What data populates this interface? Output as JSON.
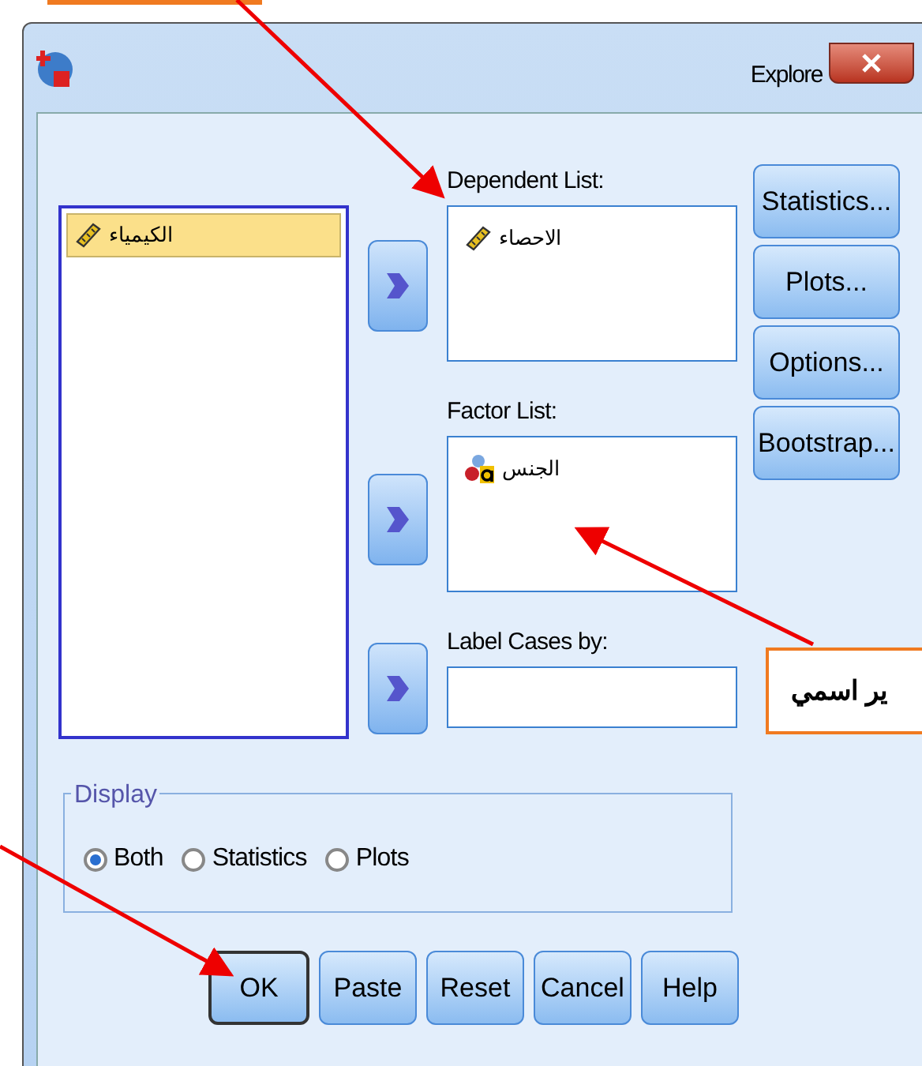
{
  "window": {
    "title": "Explore"
  },
  "source_list": {
    "items": [
      {
        "label": "الكيمياء",
        "selected": true,
        "kind": "scale"
      }
    ]
  },
  "dependent_list": {
    "label": "Dependent List:",
    "items": [
      {
        "label": "الاحصاء",
        "kind": "scale"
      }
    ]
  },
  "factor_list": {
    "label": "Factor List:",
    "items": [
      {
        "label": "الجنس",
        "kind": "nominal"
      }
    ]
  },
  "label_cases": {
    "label": "Label Cases by:"
  },
  "side_buttons": [
    "Statistics...",
    "Plots...",
    "Options...",
    "Bootstrap..."
  ],
  "display": {
    "title": "Display",
    "options": [
      {
        "label": "Both",
        "selected": true
      },
      {
        "label": "Statistics",
        "selected": false
      },
      {
        "label": "Plots",
        "selected": false
      }
    ]
  },
  "buttons": [
    {
      "label": "OK",
      "default": true
    },
    {
      "label": "Paste",
      "default": false
    },
    {
      "label": "Reset",
      "default": false
    },
    {
      "label": "Cancel",
      "default": false
    },
    {
      "label": "Help",
      "default": false
    }
  ],
  "callout": {
    "text": "ير اسمي"
  }
}
